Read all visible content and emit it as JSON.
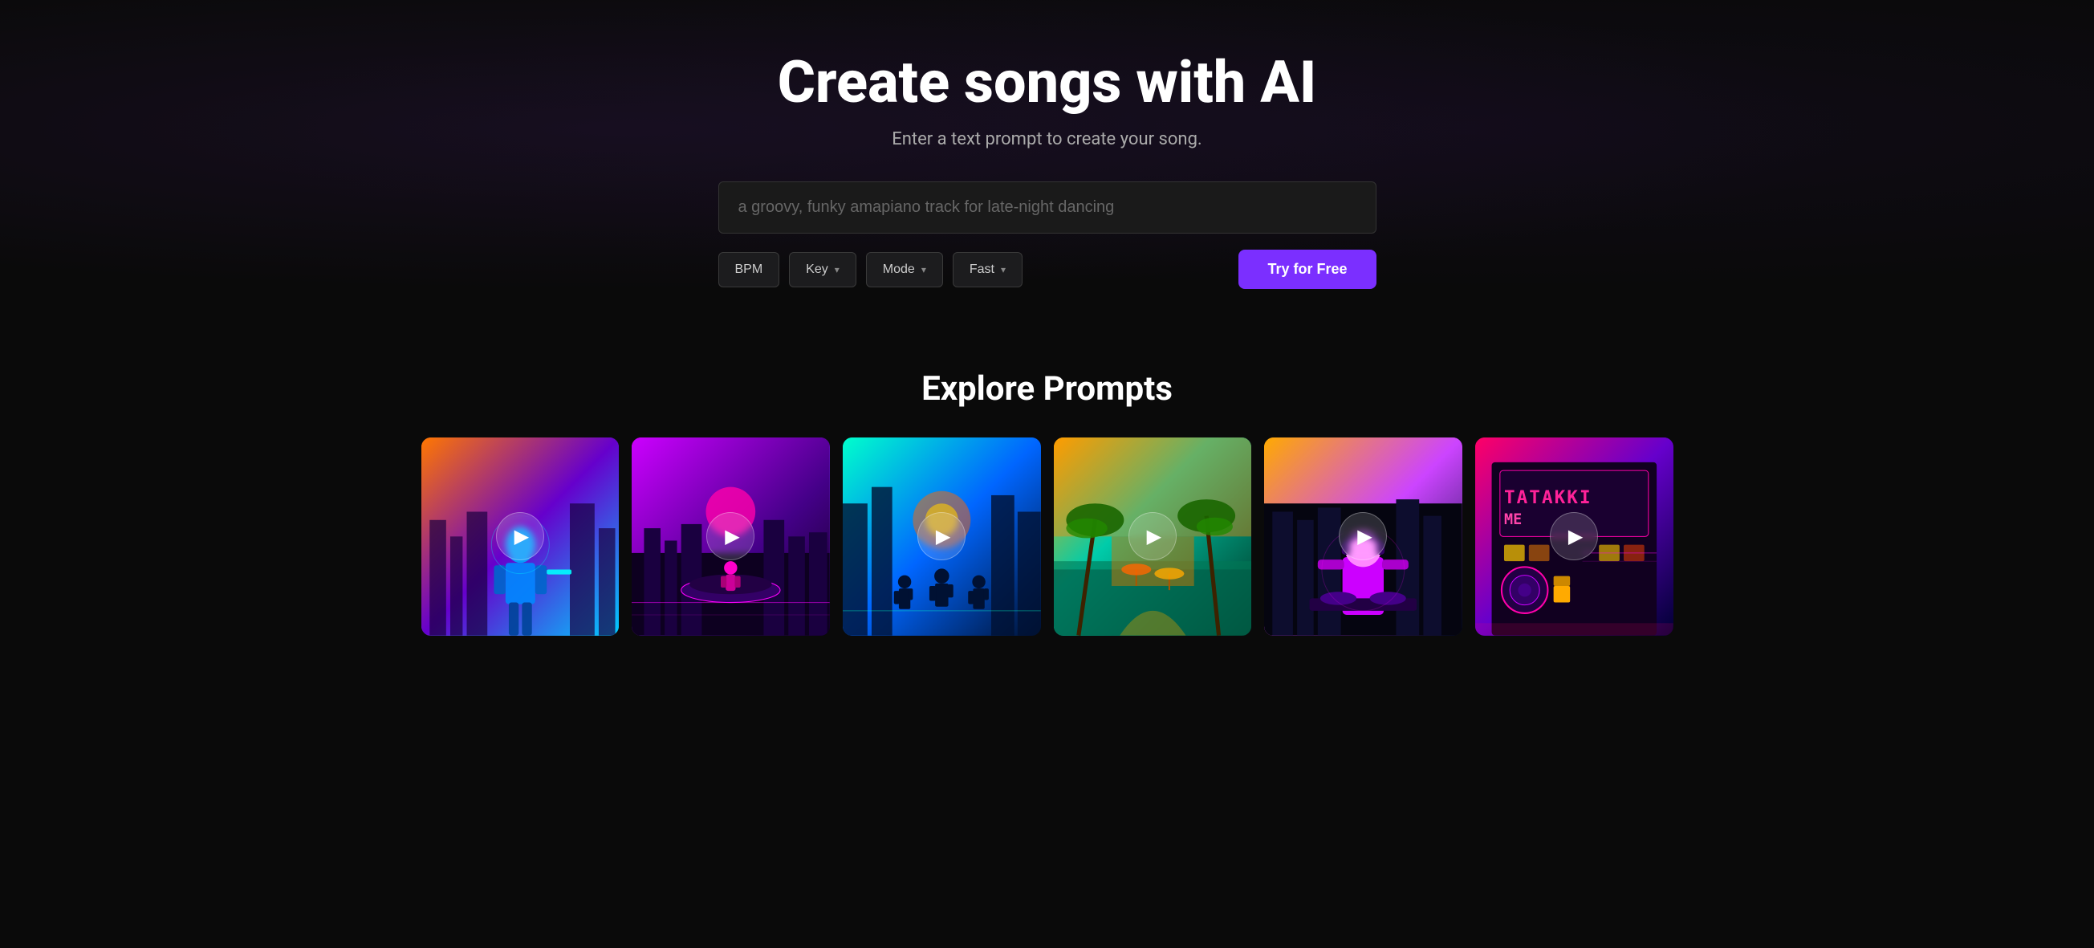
{
  "hero": {
    "title": "Create songs with AI",
    "subtitle": "Enter a text prompt to create your song.",
    "prompt_placeholder": "a groovy, funky amapiano track for late-night dancing",
    "prompt_value": "a groovy, funky amapiano track for late-night dancing"
  },
  "controls": {
    "bpm_label": "BPM",
    "key_label": "Key",
    "mode_label": "Mode",
    "speed_label": "Fast",
    "try_free_label": "Try for Free"
  },
  "explore": {
    "section_title": "Explore Prompts"
  },
  "cards": [
    {
      "id": 1,
      "play_label": "▶"
    },
    {
      "id": 2,
      "play_label": "▶"
    },
    {
      "id": 3,
      "play_label": "▶"
    },
    {
      "id": 4,
      "play_label": "▶"
    },
    {
      "id": 5,
      "play_label": "▶"
    },
    {
      "id": 6,
      "play_label": "▶"
    }
  ],
  "colors": {
    "accent": "#7b2fff",
    "background": "#0a0a0a",
    "input_bg": "#1a1a1a",
    "border": "#333333"
  }
}
